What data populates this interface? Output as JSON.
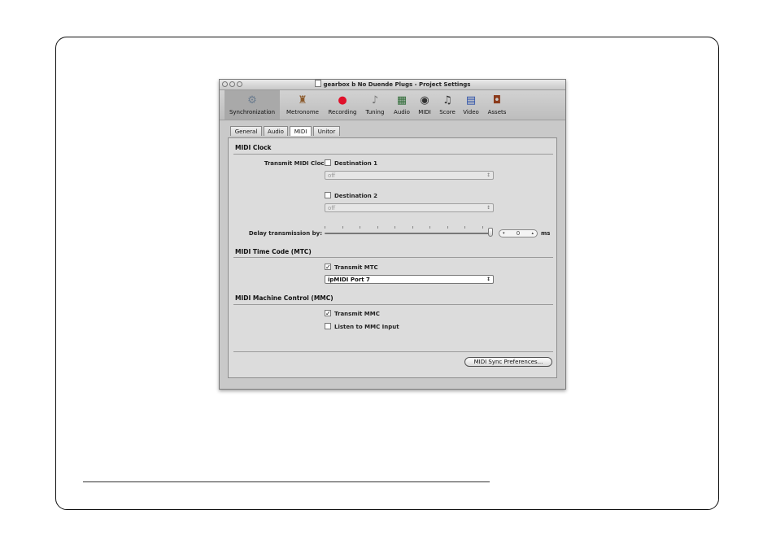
{
  "window": {
    "title": "gearbox b No Duende Plugs - Project Settings"
  },
  "toolbar": {
    "items": [
      {
        "label": "Synchronization",
        "icon": "gears-icon"
      },
      {
        "label": "Metronome",
        "icon": "metronome-icon"
      },
      {
        "label": "Recording",
        "icon": "record-icon"
      },
      {
        "label": "Tuning",
        "icon": "tuning-fork-icon"
      },
      {
        "label": "Audio",
        "icon": "audio-waveform-icon"
      },
      {
        "label": "MIDI",
        "icon": "midi-connector-icon"
      },
      {
        "label": "Score",
        "icon": "score-icon"
      },
      {
        "label": "Video",
        "icon": "video-film-icon"
      },
      {
        "label": "Assets",
        "icon": "briefcase-icon"
      }
    ],
    "selected": "Synchronization"
  },
  "tabs": [
    {
      "label": "General"
    },
    {
      "label": "Audio"
    },
    {
      "label": "MIDI"
    },
    {
      "label": "Unitor"
    }
  ],
  "active_tab": "MIDI",
  "midi_clock": {
    "title": "MIDI Clock",
    "transmit_label": "Transmit MIDI Clock:",
    "destination1_label": "Destination 1",
    "destination1_checked": false,
    "destination1_value": "off",
    "destination2_label": "Destination 2",
    "destination2_checked": false,
    "destination2_value": "off",
    "delay_label": "Delay transmission by:",
    "delay_value": "0",
    "delay_unit": "ms"
  },
  "mtc": {
    "title": "MIDI Time Code (MTC)",
    "transmit_label": "Transmit MTC",
    "transmit_checked": true,
    "port_value": "ipMIDI Port 7"
  },
  "mmc": {
    "title": "MIDI Machine Control (MMC)",
    "transmit_label": "Transmit MMC",
    "transmit_checked": true,
    "listen_label": "Listen to MMC Input",
    "listen_checked": false
  },
  "footer": {
    "sync_prefs_label": "MIDI Sync Preferences..."
  },
  "symbols": {
    "check": "✓",
    "up_down": "↕",
    "step_down": "▾",
    "step_up": "▴",
    "gears": "⚙",
    "metronome": "♜",
    "record": "●",
    "tuning": "♪",
    "audio": "▦",
    "midi": "◉",
    "score": "♫",
    "video": "▤",
    "assets": "◘"
  }
}
